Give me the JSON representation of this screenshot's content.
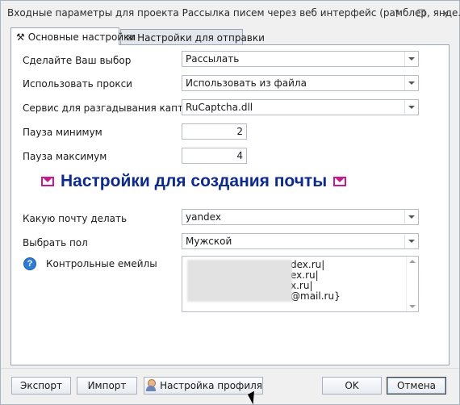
{
  "window": {
    "title": "Входные параметры для проекта Рассылка писем через веб интерфейс (рамблер, янде...",
    "controls": [
      "help-icon",
      "restore-icon",
      "close-icon"
    ]
  },
  "tabs": [
    {
      "label": "Основные настройки",
      "icon": "tools-icon",
      "active": true
    },
    {
      "label": "Настройки для отправки",
      "icon": "envelope-icon",
      "active": false
    }
  ],
  "form": {
    "choice": {
      "label": "Сделайте Ваш выбор",
      "value": "Рассылать"
    },
    "proxy": {
      "label": "Использовать прокси",
      "value": "Использовать из файла"
    },
    "captcha": {
      "label": "Сервис для разгадывания каптчи",
      "value": "RuCaptcha.dll"
    },
    "pause_min": {
      "label": "Пауза минимум",
      "value": "2"
    },
    "pause_max": {
      "label": "Пауза максимум",
      "value": "4"
    },
    "section_title": "Настройки для создания почты",
    "mail_type": {
      "label": "Какую почту делать",
      "value": "yandex"
    },
    "gender": {
      "label": "Выбрать пол",
      "value": "Мужской"
    },
    "control_emails": {
      "label": "Контрольные емейлы",
      "lines": [
        "dex.ru|",
        "ex.ru|",
        "x.ru|",
        "@mail.ru}"
      ]
    }
  },
  "buttons": {
    "export": "Экспорт",
    "import": "Импорт",
    "profile": "Настройка профиля",
    "ok": "OK",
    "cancel": "Отмена"
  },
  "colors": {
    "section_title": "#0b2a8a",
    "envelope_accent": "#c8198e",
    "info_icon": "#2f7dd3"
  }
}
